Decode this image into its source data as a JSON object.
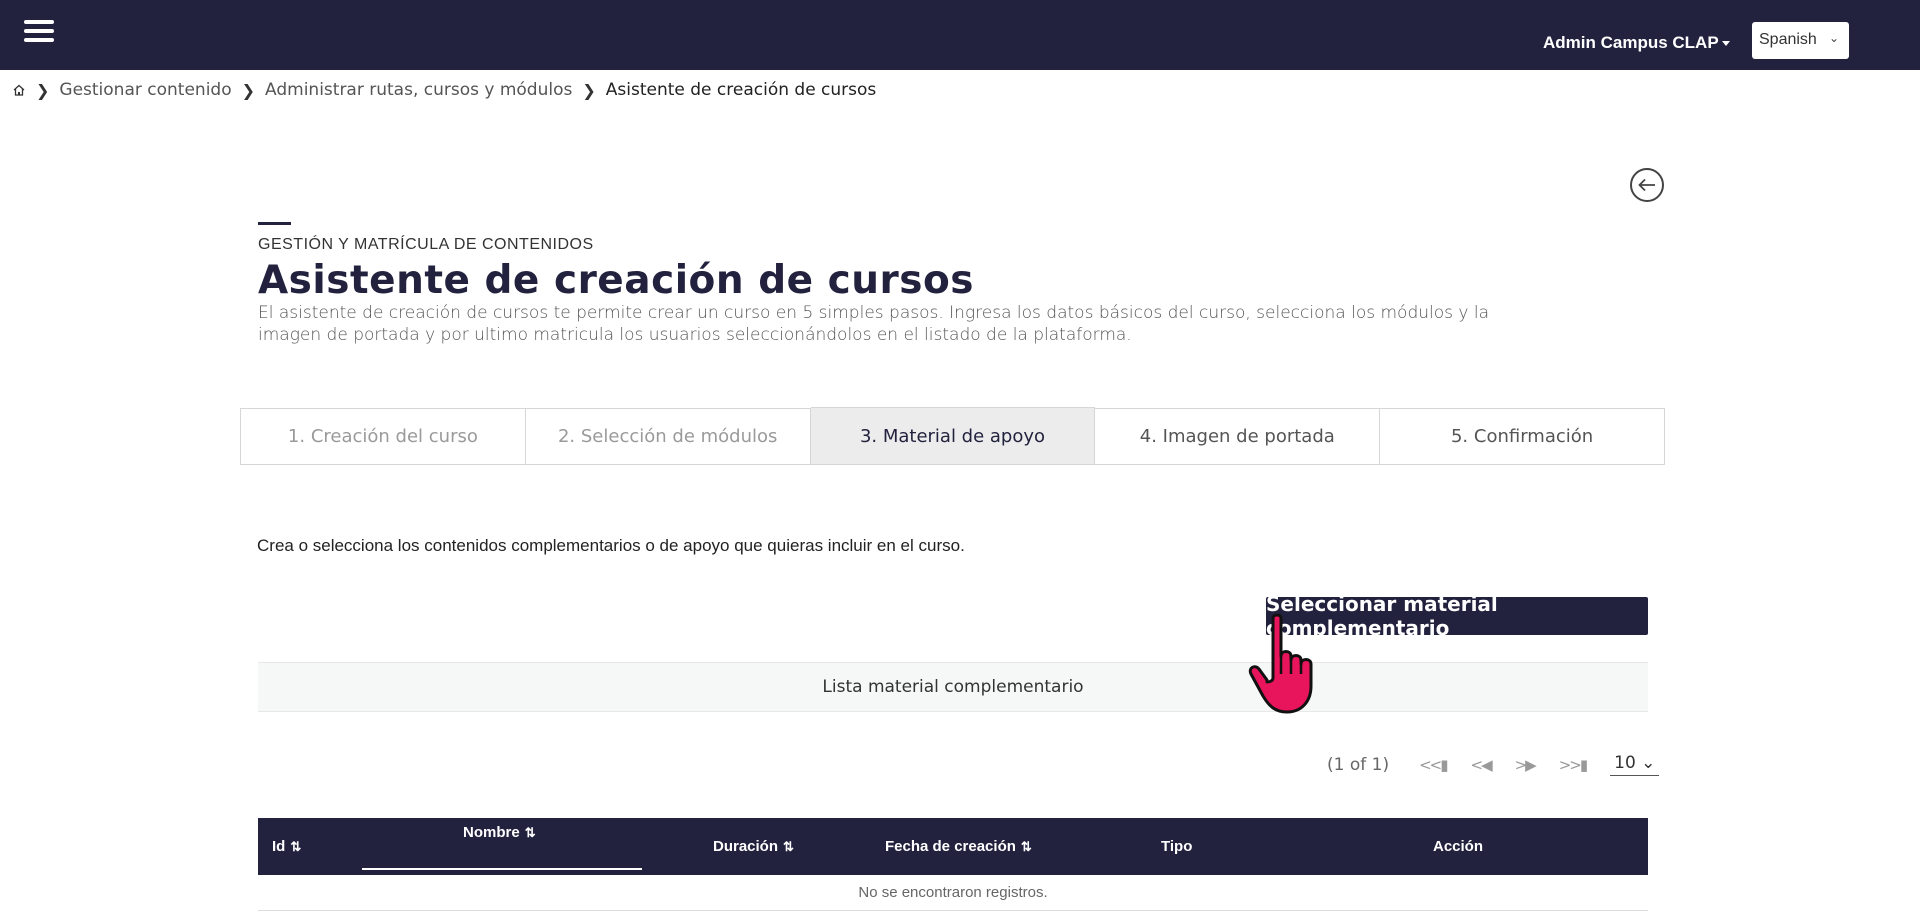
{
  "header": {
    "user_menu": "Admin Campus CLAP",
    "language": "Spanish"
  },
  "breadcrumb": {
    "items": [
      "Gestionar contenido",
      "Administrar rutas, cursos y módulos"
    ],
    "current": "Asistente de creación de cursos"
  },
  "page": {
    "overline": "GESTIÓN Y MATRÍCULA DE CONTENIDOS",
    "title": "Asistente de creación de cursos",
    "description": "El asistente de creación de cursos te permite crear un curso en 5 simples pasos. Ingresa los datos básicos del curso, selecciona los módulos y la imagen de portada y por ultimo matricula los usuarios seleccionándolos en el listado de la plataforma."
  },
  "tabs": [
    {
      "label": "1. Creación del curso"
    },
    {
      "label": "2. Selección de módulos"
    },
    {
      "label": "3. Material de apoyo"
    },
    {
      "label": "4. Imagen de portada"
    },
    {
      "label": "5. Confirmación"
    }
  ],
  "active_tab": "3. Material de apoyo",
  "content": {
    "intro": "Crea o selecciona los contenidos complementarios o de apoyo que quieras incluir en el curso.",
    "select_button": "Seleccionar material complementario",
    "list_title": "Lista material complementario"
  },
  "pagination": {
    "info": "(1 of 1)",
    "rows_per_page": "10"
  },
  "table": {
    "columns": [
      "Id",
      "Nombre",
      "Duración",
      "Fecha de creación",
      "Tipo",
      "Acción"
    ],
    "empty_message": "No se encontraron registros."
  },
  "colors": {
    "primary": "#22223f",
    "cursor": "#e8145c"
  }
}
